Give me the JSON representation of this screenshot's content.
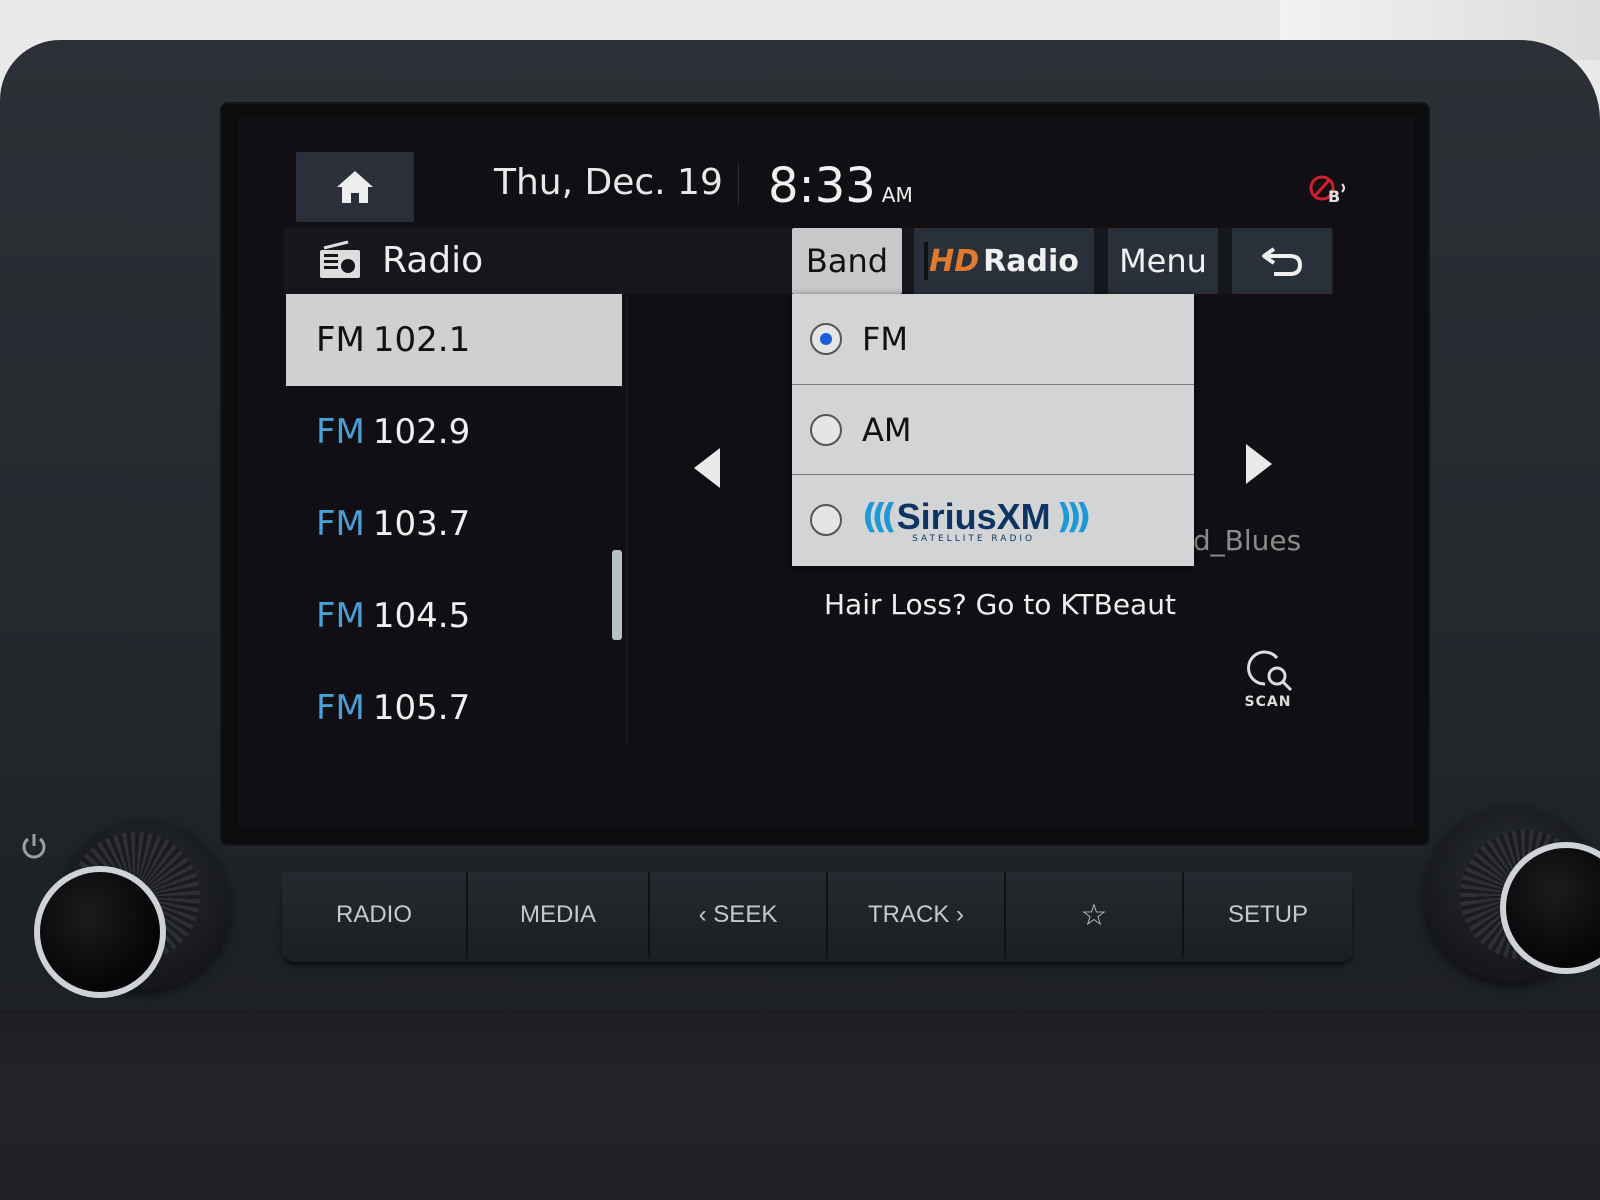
{
  "status_bar": {
    "home_icon": "home-icon",
    "date": "Thu, Dec. 19",
    "time": "8:33",
    "ampm": "AM",
    "bluetooth_status_icon": "bluetooth-disabled-icon",
    "bluetooth_badge": "B"
  },
  "title_bar": {
    "icon": "radio-icon",
    "title": "Radio",
    "buttons": {
      "band": "Band",
      "hd_radio_prefix": "HD",
      "hd_radio": "Radio",
      "menu": "Menu",
      "back_icon": "back-arrow-icon"
    }
  },
  "presets": [
    {
      "band": "FM",
      "freq": "102.1",
      "active": true
    },
    {
      "band": "FM",
      "freq": "102.9",
      "active": false
    },
    {
      "band": "FM",
      "freq": "103.7",
      "active": false
    },
    {
      "band": "FM",
      "freq": "104.5",
      "active": false
    },
    {
      "band": "FM",
      "freq": "105.7",
      "active": false
    }
  ],
  "band_dropdown": {
    "options": [
      {
        "label": "FM",
        "selected": true
      },
      {
        "label": "AM",
        "selected": false
      },
      {
        "label": "SiriusXM",
        "sublabel": "SATELLITE RADIO",
        "selected": false
      }
    ]
  },
  "now_playing": {
    "genre_partial": "and_Blues",
    "radio_text": "Hair Loss? Go to KTBeaut"
  },
  "scan": {
    "label": "SCAN",
    "icon": "scan-icon"
  },
  "hard_keys": [
    {
      "label": "RADIO"
    },
    {
      "label": "MEDIA"
    },
    {
      "label": "‹ SEEK"
    },
    {
      "label": "TRACK ›"
    },
    {
      "label": "☆",
      "icon": "star-icon"
    },
    {
      "label": "SETUP"
    }
  ],
  "colors": {
    "accent_blue": "#4a9fd8",
    "hd_orange": "#e07a2e",
    "sirius_blue": "#0e3463",
    "bt_red": "#d0202e"
  }
}
